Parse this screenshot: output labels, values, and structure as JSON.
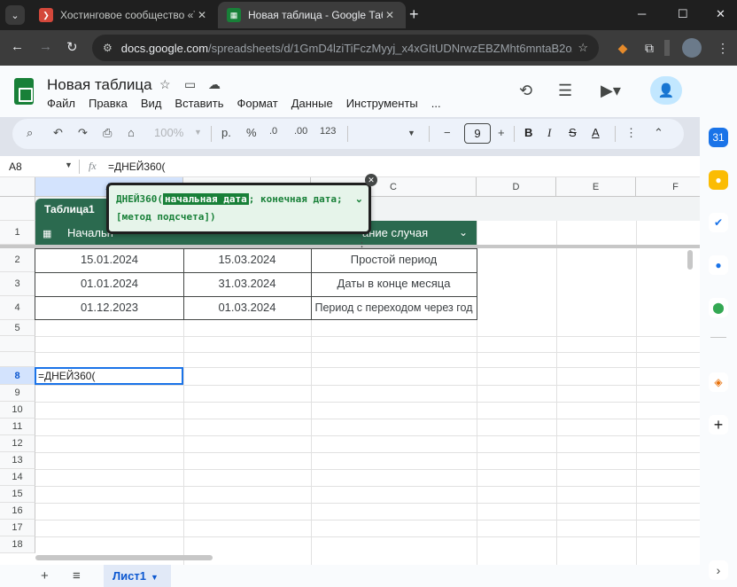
{
  "browser": {
    "tabs": [
      {
        "title": "Хостинговое сообщество «Tim",
        "active": false
      },
      {
        "title": "Новая таблица - Google Табл",
        "active": true
      }
    ],
    "url_host": "docs.google.com",
    "url_path": "/spreadsheets/d/1GmD4lziTiFczMyyj_x4xGItUDNrwzEBZMht6mntaB2o/e..."
  },
  "doc": {
    "title": "Новая таблица",
    "menu": [
      "Файл",
      "Правка",
      "Вид",
      "Вставить",
      "Формат",
      "Данные",
      "Инструменты",
      "..."
    ]
  },
  "toolbar": {
    "zoom": "100%",
    "currency": "р.",
    "percent": "%",
    "dec_decrease": ".0",
    "dec_increase": ".00",
    "number_format": "123",
    "font_size": "9",
    "bold": "B",
    "text_color": "A"
  },
  "formula_bar": {
    "cell_ref": "A8",
    "fx": "fx",
    "formula": "=ДНЕЙ360("
  },
  "grid": {
    "columns": [
      "A",
      "B",
      "C",
      "D",
      "E",
      "F"
    ],
    "rows": [
      "1",
      "2",
      "3",
      "4",
      "5",
      "8",
      "9",
      "10",
      "11",
      "12",
      "13",
      "14",
      "15",
      "16",
      "17",
      "18"
    ],
    "table_name": "Таблица1",
    "headers": [
      "Начальн",
      "ание случая"
    ],
    "data": [
      [
        "15.01.2024",
        "15.03.2024",
        "Простой период"
      ],
      [
        "01.01.2024",
        "31.03.2024",
        "Даты в конце месяца"
      ],
      [
        "01.12.2023",
        "01.03.2024",
        "Период с переходом через год"
      ]
    ],
    "active_cell_text": "=ДНЕЙ360("
  },
  "fn_hint": {
    "name": "ДНЕЙ360(",
    "arg_highlight": "начальная дата",
    "rest_line1": "; конечная дата;",
    "line2": "[метод подсчета])"
  },
  "sheets": {
    "active": "Лист1"
  },
  "colors": {
    "table_header": "#2b6a4f",
    "accent": "#1a73e8",
    "hint_bg": "#e6f4ea",
    "hint_text": "#188038"
  }
}
